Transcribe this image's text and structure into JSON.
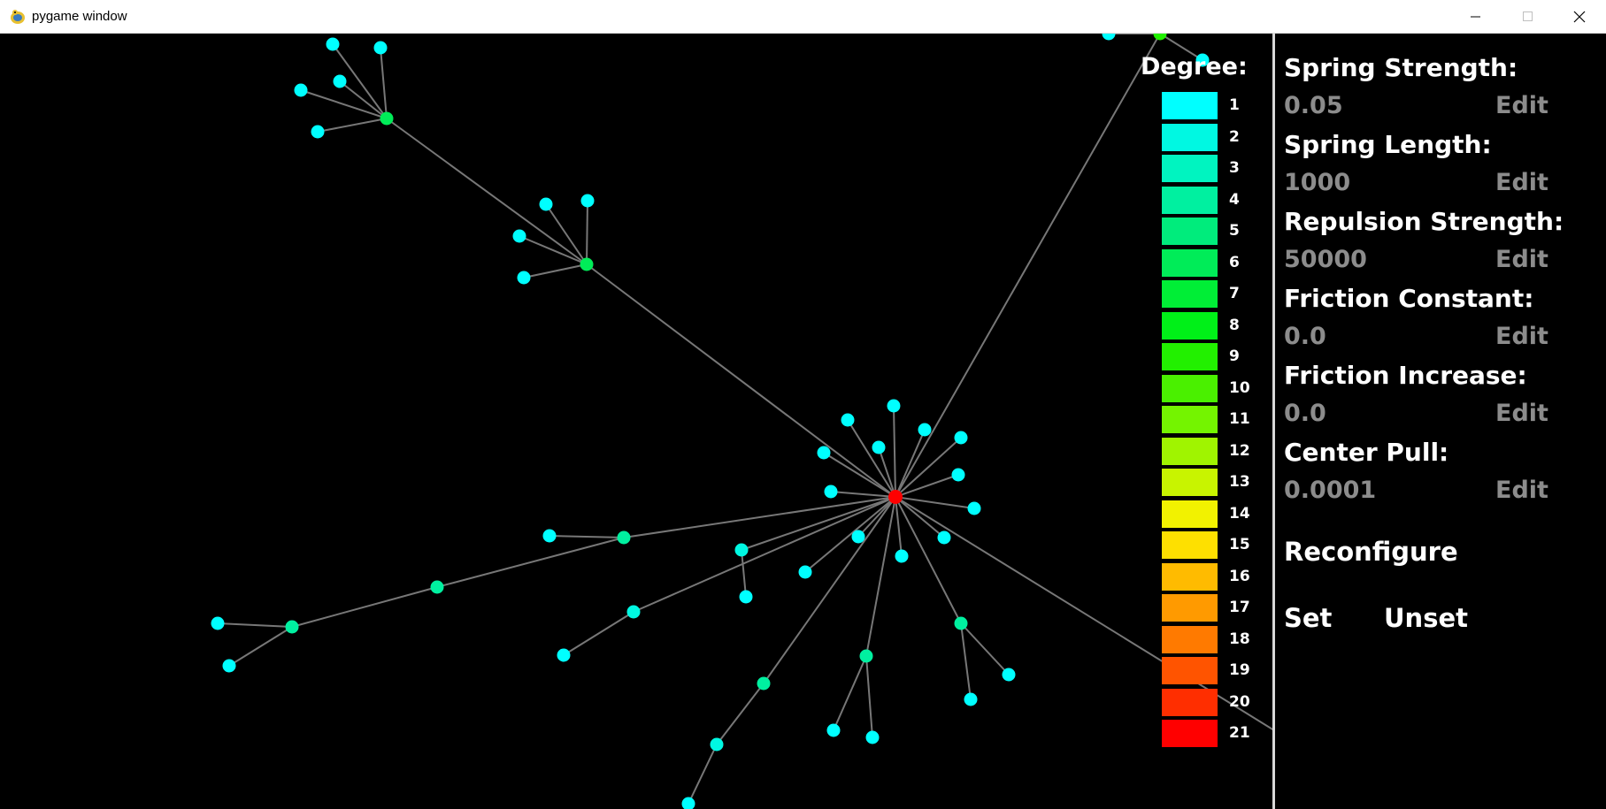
{
  "window": {
    "title": "pygame window",
    "icons": {
      "app": "pygame-snake-icon",
      "minimize": "minimize-icon",
      "maximize": "maximize-icon",
      "close": "close-icon"
    }
  },
  "legend": {
    "title": "Degree:",
    "items": [
      {
        "label": "1",
        "color": "#00ffff"
      },
      {
        "label": "2",
        "color": "#00f8e2"
      },
      {
        "label": "3",
        "color": "#00f4c0"
      },
      {
        "label": "4",
        "color": "#00f0a0"
      },
      {
        "label": "5",
        "color": "#00ec7c"
      },
      {
        "label": "6",
        "color": "#00ec58"
      },
      {
        "label": "7",
        "color": "#00ee36"
      },
      {
        "label": "8",
        "color": "#00f018"
      },
      {
        "label": "9",
        "color": "#22f000"
      },
      {
        "label": "10",
        "color": "#4af000"
      },
      {
        "label": "11",
        "color": "#74f400"
      },
      {
        "label": "12",
        "color": "#a0f400"
      },
      {
        "label": "13",
        "color": "#c8f400"
      },
      {
        "label": "14",
        "color": "#f2f200"
      },
      {
        "label": "15",
        "color": "#fee000"
      },
      {
        "label": "16",
        "color": "#ffbb00"
      },
      {
        "label": "17",
        "color": "#ff9a00"
      },
      {
        "label": "18",
        "color": "#ff7a00"
      },
      {
        "label": "19",
        "color": "#ff5400"
      },
      {
        "label": "20",
        "color": "#ff2e00"
      },
      {
        "label": "21",
        "color": "#ff0000"
      }
    ]
  },
  "params": [
    {
      "label": "Spring Strength:",
      "value": "0.05",
      "edit": "Edit"
    },
    {
      "label": "Spring Length:",
      "value": "1000",
      "edit": "Edit"
    },
    {
      "label": "Repulsion Strength:",
      "value": "50000",
      "edit": "Edit"
    },
    {
      "label": "Friction Constant:",
      "value": "0.0",
      "edit": "Edit"
    },
    {
      "label": "Friction Increase:",
      "value": "0.0",
      "edit": "Edit"
    },
    {
      "label": "Center Pull:",
      "value": "0.0001",
      "edit": "Edit"
    }
  ],
  "actions": {
    "reconfigure": "Reconfigure",
    "set": "Set",
    "unset": "Unset"
  },
  "graph": {
    "edge_color": "#777777",
    "node_degree_colors": {
      "leaf": "#00ffff",
      "mid": "#00f0a0",
      "hub": "#00ec58",
      "center": "#ff0000"
    }
  }
}
